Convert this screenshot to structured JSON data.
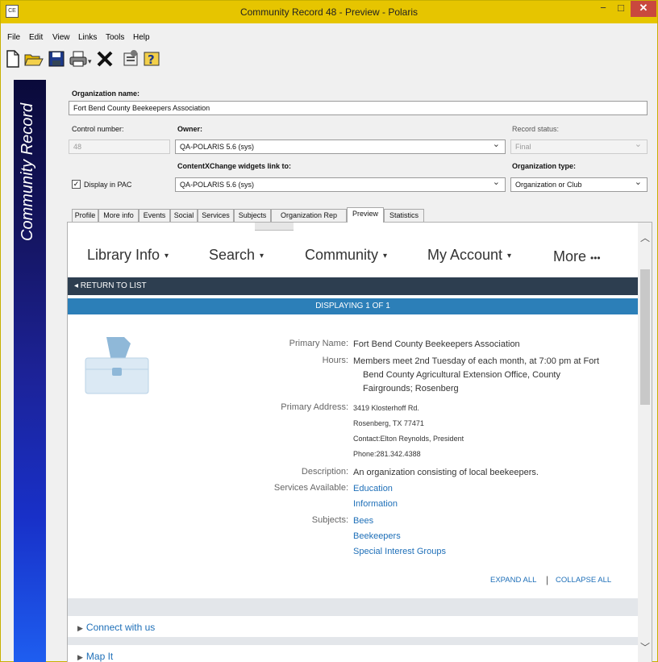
{
  "window": {
    "title": "Community Record 48 - Preview - Polaris",
    "icon_text": "CE",
    "minimize": "−",
    "maximize": "□",
    "close": "✕"
  },
  "menu": [
    "File",
    "Edit",
    "View",
    "Links",
    "Tools",
    "Help"
  ],
  "toolbar": [
    "new-icon",
    "open-folder-icon",
    "save-icon",
    "print-icon",
    "delete-icon",
    "properties-icon",
    "help-icon"
  ],
  "banner": {
    "text": "Community Record"
  },
  "form": {
    "org_name_label": "Organization name:",
    "org_name_value": "Fort Bend County Beekeepers Association",
    "control_number_label": "Control number:",
    "control_number_value": "48",
    "owner_label": "Owner:",
    "owner_value": "QA-POLARIS 5.6 (sys)",
    "record_status_label": "Record status:",
    "record_status_value": "Final",
    "contentx_label": "ContentXChange widgets link to:",
    "contentx_value": "QA-POLARIS 5.6 (sys)",
    "org_type_label": "Organization type:",
    "org_type_value": "Organization or Club",
    "display_pac_label": "Display in PAC",
    "display_pac_checked": true
  },
  "tabs": [
    "Profile",
    "More info",
    "Events",
    "Social",
    "Services",
    "Subjects",
    "Organization Rep",
    "Preview",
    "Statistics"
  ],
  "active_tab": "Preview",
  "preview": {
    "nav": [
      "Library Info",
      "Search",
      "Community",
      "My Account",
      "More"
    ],
    "nav_more_dots": "•••",
    "return_label": "◂ RETURN TO LIST",
    "displaying_label": "DISPLAYING 1 OF 1",
    "primary_name_label": "Primary Name:",
    "primary_name": "Fort Bend County Beekeepers Association",
    "hours_label": "Hours:",
    "hours_line1": "Members meet 2nd Tuesday of each month, at 7:00 pm at Fort",
    "hours_line2": "Bend County Agricultural Extension Office, County",
    "hours_line3": "Fairgrounds; Rosenberg",
    "address_label": "Primary Address:",
    "address_lines": [
      "3419 Klosterhoff Rd.",
      "Rosenberg, TX 77471",
      "Contact:Elton Reynolds, President",
      "Phone:281.342.4388"
    ],
    "description_label": "Description:",
    "description": "An organization consisting of local beekeepers.",
    "services_label": "Services Available:",
    "services": [
      "Education",
      "Information"
    ],
    "subjects_label": "Subjects:",
    "subjects": [
      "Bees",
      "Beekeepers",
      "Special Interest Groups"
    ],
    "expand_all": "EXPAND ALL",
    "separator": "|",
    "collapse_all": "COLLAPSE ALL",
    "connect_label": "Connect with us",
    "map_label": "Map It"
  },
  "colors": {
    "titlebar": "#e6c500",
    "return_bar": "#2d3e50",
    "display_bar": "#2c7fb8",
    "link": "#1e6fb8",
    "close_button": "#c9483e"
  }
}
